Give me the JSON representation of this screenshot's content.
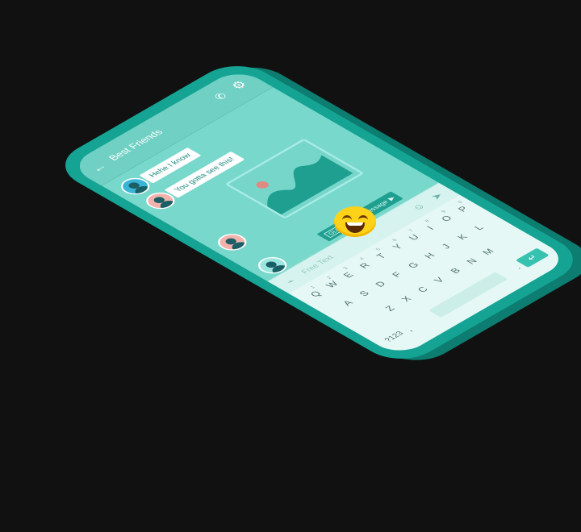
{
  "app": {
    "title": "Best Friends"
  },
  "messages": [
    {
      "text": "Hehe I know"
    },
    {
      "text": "You gotta see this!"
    }
  ],
  "new_message": {
    "tag": "GLO",
    "label": "1 New Message",
    "chevron": "▶"
  },
  "input": {
    "placeholder": "Free Text"
  },
  "keyboard": {
    "row1": [
      "Q",
      "W",
      "E",
      "R",
      "T",
      "Y",
      "U",
      "I",
      "O",
      "P"
    ],
    "row1_sup": [
      "1",
      "2",
      "3",
      "4",
      "5",
      "6",
      "7",
      "8",
      "9",
      "0"
    ],
    "row2": [
      "A",
      "S",
      "D",
      "F",
      "G",
      "H",
      "J",
      "K",
      "L"
    ],
    "row3": [
      "Z",
      "X",
      "C",
      "V",
      "B",
      "N",
      "M"
    ],
    "numsym": "?123",
    "comma": ",",
    "period": "."
  },
  "colors": {
    "background": "#111111",
    "phone_body": "#15a393",
    "screen": "#79d8cc",
    "accent": "#37c2b0"
  },
  "icons": {
    "back": "arrow-left-icon",
    "call": "phone-icon",
    "settings": "gear-icon",
    "attach": "paperclip-icon",
    "emoji": "smiley-icon",
    "send": "send-icon"
  }
}
